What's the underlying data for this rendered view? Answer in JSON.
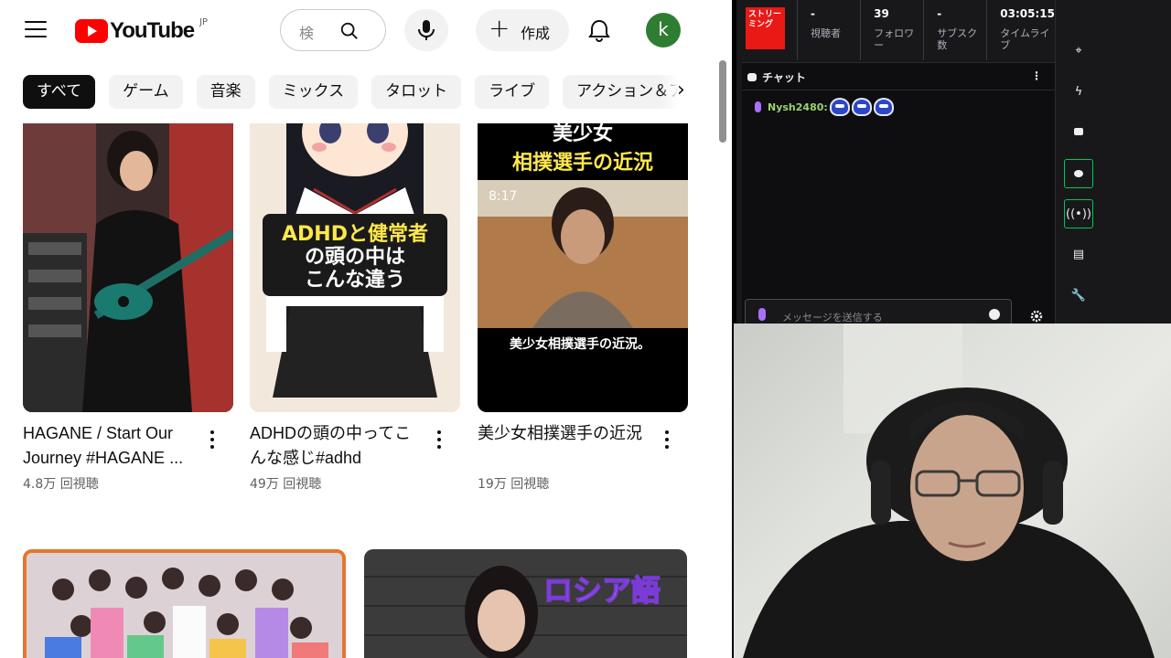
{
  "youtube": {
    "logo_text": "YouTube",
    "region": "JP",
    "search_placeholder": "検",
    "create_label": "作成",
    "avatar_letter": "k",
    "chips": [
      "すべて",
      "ゲーム",
      "音楽",
      "ミックス",
      "タロット",
      "ライブ",
      "アクション＆ア"
    ],
    "videos": [
      {
        "title": "HAGANE / Start Our Journey #HAGANE ...",
        "views": "4.8万 回視聴"
      },
      {
        "title": "ADHDの頭の中ってこんな感じ#adhd",
        "views": "49万 回視聴"
      },
      {
        "title": "美少女相撲選手の近況",
        "views": "19万 回視聴"
      }
    ],
    "thumb_texts": {
      "adhd": [
        "ADHDと健常者",
        "の頭の中は",
        "こんな違う"
      ],
      "sumo_top": [
        "美少女",
        "相撲選手の近況"
      ],
      "sumo_time": "8:17",
      "sumo_bottom": "美少女相撲選手の近況。",
      "russian": "ロシア語"
    }
  },
  "dashboard": {
    "live_badge": "ストリーミング",
    "stats": [
      {
        "value": "-",
        "label": "視聴者"
      },
      {
        "value": "39",
        "label": "フォロワー"
      },
      {
        "value": "-",
        "label": "サブスク数"
      },
      {
        "value": "03:05:15",
        "label": "タイムライブ"
      }
    ],
    "chat_title": "チャット",
    "messages": [
      {
        "user": "Nysh2480:"
      }
    ],
    "input_placeholder": "メッセージを送信する",
    "colors": {
      "live": "#e91916",
      "accent": "#a970ff",
      "active_border": "#00c853",
      "username": "#9bd36b"
    }
  }
}
